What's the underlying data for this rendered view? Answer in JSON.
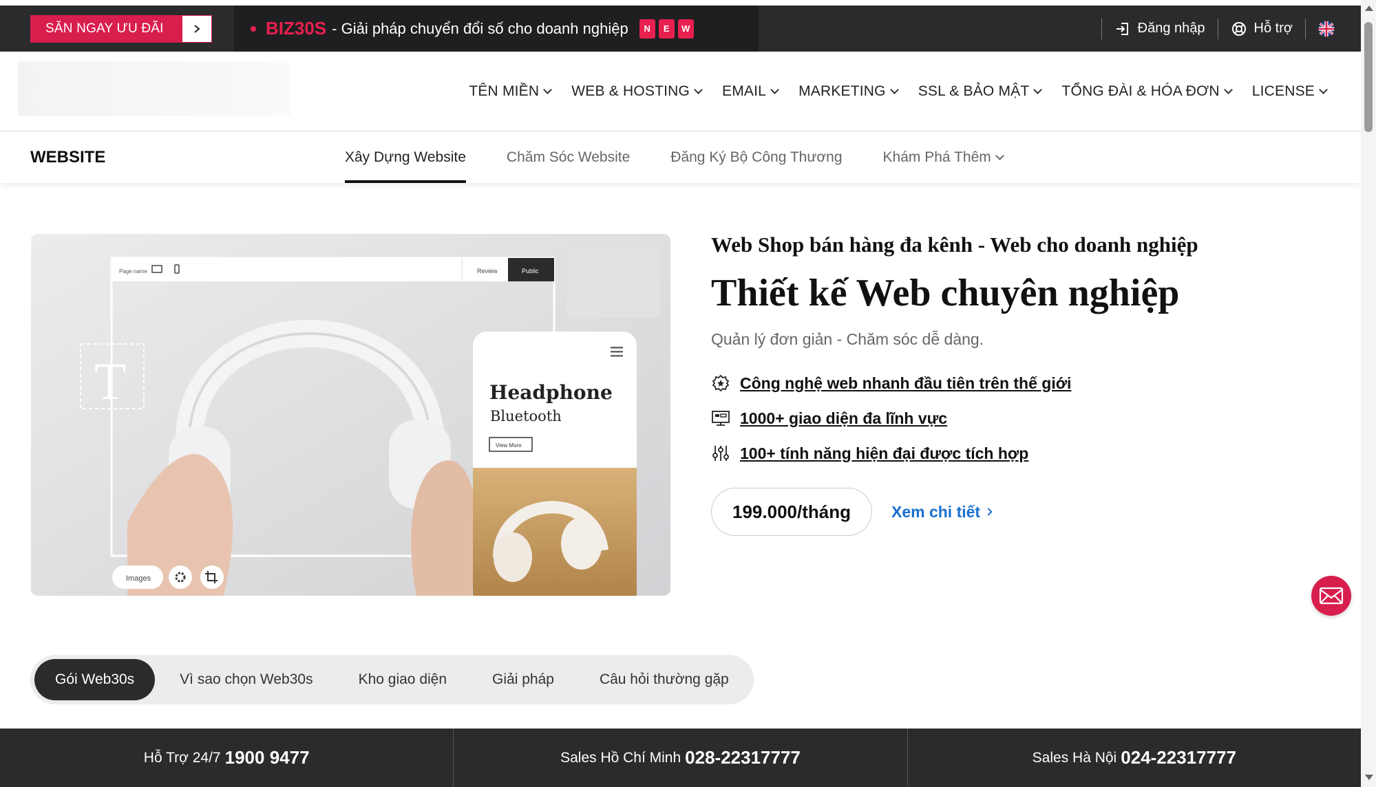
{
  "topbar": {
    "promo_label": "SĂN NGAY ƯU ĐÃI",
    "announcement": {
      "brand": "BIZ30S",
      "message": "- Giải pháp chuyển đổi số cho doanh nghiệp",
      "badges": [
        "N",
        "E",
        "W"
      ]
    },
    "login_label": "Đăng nhập",
    "support_label": "Hỗ trợ"
  },
  "nav": {
    "items": [
      {
        "label": "TÊN MIỀN"
      },
      {
        "label": "WEB & HOSTING"
      },
      {
        "label": "EMAIL"
      },
      {
        "label": "MARKETING"
      },
      {
        "label": "SSL & BẢO MẬT"
      },
      {
        "label": "TỔNG ĐÀI & HÓA ĐƠN"
      },
      {
        "label": "LICENSE"
      }
    ]
  },
  "subnav": {
    "title": "WEBSITE",
    "tabs": [
      {
        "label": "Xây Dựng Website"
      },
      {
        "label": "Chăm Sóc Website"
      },
      {
        "label": "Đăng Ký Bộ Công Thương"
      },
      {
        "label": "Khám Phá Thêm"
      }
    ]
  },
  "hero_image": {
    "toolbar_left": "Page name",
    "review": "Review",
    "public": "Public",
    "phone_title": "Headphone",
    "phone_sub": "Bluetooth",
    "phone_btn": "View More",
    "images_label": "Images"
  },
  "hero": {
    "subtitle": "Web Shop bán hàng đa kênh - Web cho doanh nghiệp",
    "title": "Thiết kế Web chuyên nghiệp",
    "description": "Quản lý đơn giản - Chăm sóc dễ dàng.",
    "features": [
      {
        "text": "Công nghệ web nhanh đầu tiên trên thế giới",
        "icon": "badge-icon"
      },
      {
        "text": "1000+ giao diện đa lĩnh vực",
        "icon": "layout-icon"
      },
      {
        "text": "100+ tính năng hiện đại được tích hợp",
        "icon": "sliders-icon"
      }
    ],
    "price": "199.000/tháng",
    "detail_link": "Xem chi tiết"
  },
  "pills": [
    {
      "label": "Gói Web30s"
    },
    {
      "label": "Vì sao chọn Web30s"
    },
    {
      "label": "Kho giao diện"
    },
    {
      "label": "Giải pháp"
    },
    {
      "label": "Câu hỏi thường gặp"
    }
  ],
  "footer": {
    "support": {
      "label": "Hỗ Trợ 24/7",
      "number": "1900 9477"
    },
    "hcm": {
      "label": "Sales Hồ Chí Minh",
      "number": "028-22317777"
    },
    "hn": {
      "label": "Sales Hà Nội",
      "number": "024-22317777"
    }
  },
  "colors": {
    "brand_red": "#d81e4d",
    "dark_bar": "#2b2b2d",
    "link_blue": "#1a6fd0"
  }
}
